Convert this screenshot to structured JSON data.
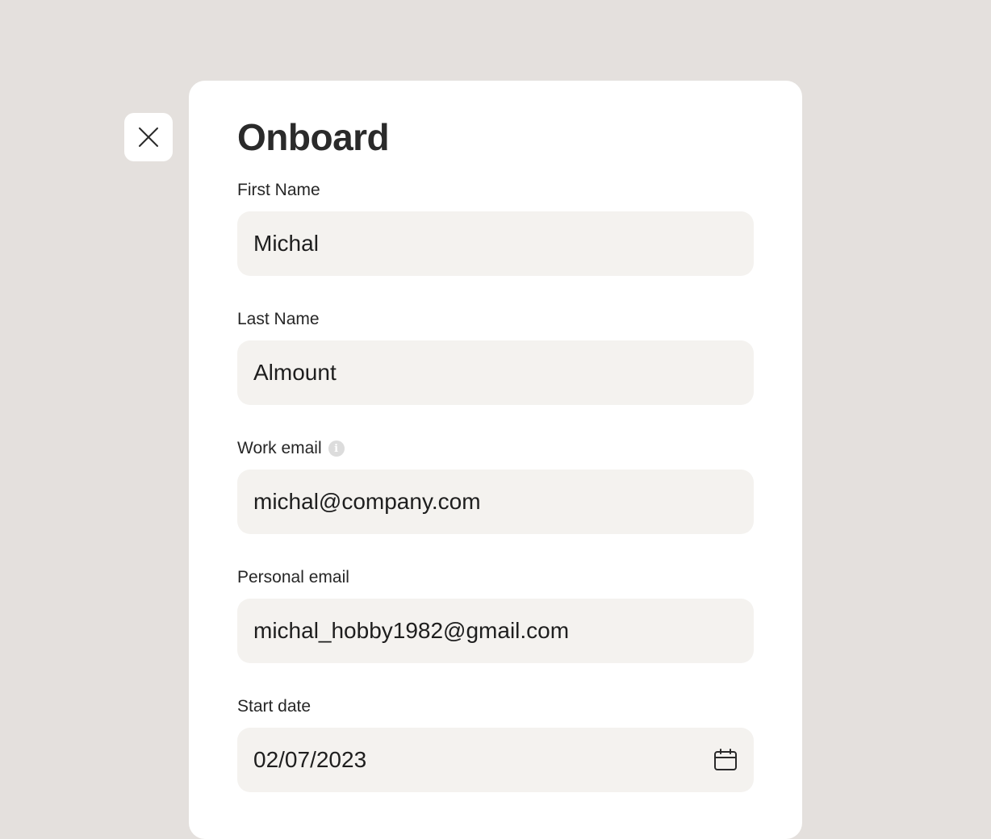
{
  "dialog": {
    "title": "Onboard"
  },
  "icons": {
    "close": "close-icon",
    "info": "info-icon",
    "calendar": "calendar-icon"
  },
  "colors": {
    "background": "#e4e0dd",
    "panel": "#ffffff",
    "input_background": "#f4f2ef",
    "text": "#222222"
  },
  "form": {
    "first_name": {
      "label": "First Name",
      "value": "Michal"
    },
    "last_name": {
      "label": "Last Name",
      "value": "Almount"
    },
    "work_email": {
      "label": "Work email",
      "value": "michal@company.com",
      "info_glyph": "i"
    },
    "personal_email": {
      "label": "Personal email",
      "value": "michal_hobby1982@gmail.com"
    },
    "start_date": {
      "label": "Start date",
      "value": "02/07/2023"
    }
  }
}
